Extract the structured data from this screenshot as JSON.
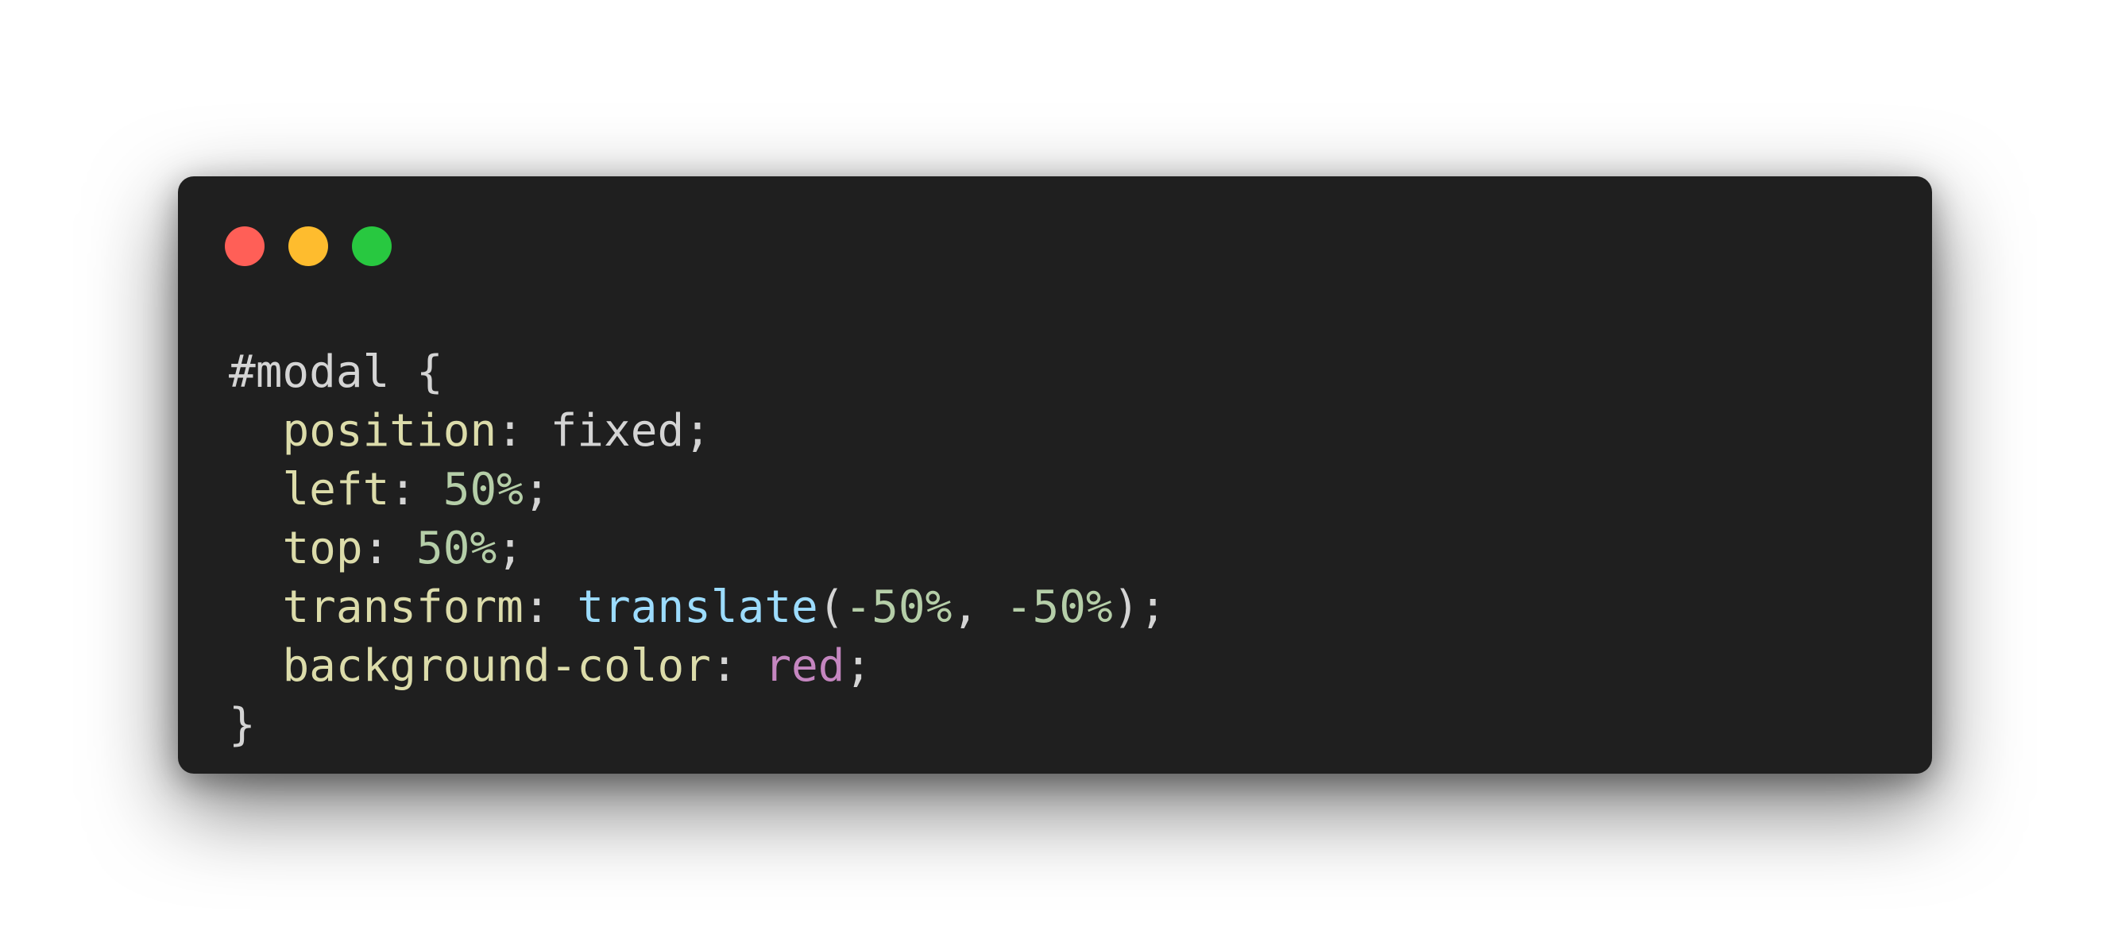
{
  "window": {
    "traffic_lights": [
      {
        "name": "close",
        "color": "#ff5f57"
      },
      {
        "name": "minimize",
        "color": "#febc2e"
      },
      {
        "name": "maximize",
        "color": "#28c840"
      }
    ]
  },
  "code": {
    "selector": "#modal {",
    "lines": [
      {
        "prop": "position",
        "colon": ": ",
        "value": "fixed",
        "end": ";"
      },
      {
        "prop": "left",
        "colon": ": ",
        "value": "50%",
        "end": ";"
      },
      {
        "prop": "top",
        "colon": ": ",
        "value": "50%",
        "end": ";"
      },
      {
        "prop": "transform",
        "colon": ": ",
        "func": "translate",
        "open": "(",
        "arg1": "-50%",
        "sep": ", ",
        "arg2": "-50%",
        "close": ")",
        "end": ";"
      },
      {
        "prop": "background-color",
        "colon": ": ",
        "value": "red",
        "end": ";"
      }
    ],
    "closing": "}"
  }
}
